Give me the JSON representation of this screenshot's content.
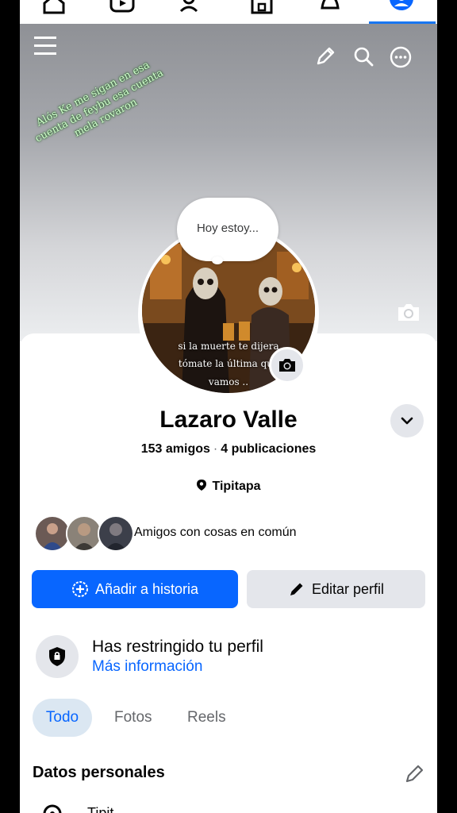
{
  "cover": {
    "caption": "Alós Ke me sigan en esa cuenta de feybu esa cuenta mela rovaron"
  },
  "note": {
    "text": "Hoy estoy..."
  },
  "profile_picture": {
    "overlay_text_1": "si la muerte te dijera",
    "overlay_text_2": "tómate la última que",
    "overlay_text_3": "vamos .."
  },
  "profile": {
    "name": "Lazaro Valle",
    "friends": "153 amigos",
    "separator": "·",
    "posts": "4 publicaciones",
    "location": "Tipitapa",
    "mutual_text": "Amigos con cosas en común"
  },
  "actions": {
    "add_story": "Añadir a historia",
    "edit_profile": "Editar perfil"
  },
  "restricted": {
    "title": "Has restringido tu perfil",
    "link": "Más información"
  },
  "tabs": [
    {
      "label": "Todo",
      "active": true
    },
    {
      "label": "Fotos",
      "active": false
    },
    {
      "label": "Reels",
      "active": false
    }
  ],
  "personal": {
    "title": "Datos personales",
    "first_item": "Tipit..."
  },
  "colors": {
    "accent": "#0866ff",
    "secondary_button": "#e4e6eb",
    "active_tab_bg": "#dbe7f2"
  }
}
